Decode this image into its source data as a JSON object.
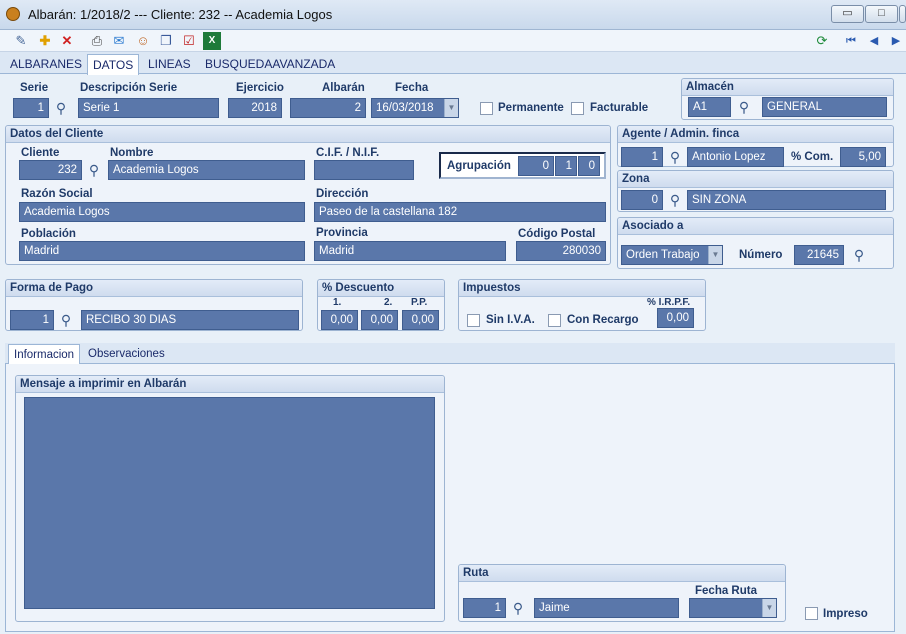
{
  "window": {
    "title": "Albarán: 1/2018/2  ---  Cliente: 232  --  Academia Logos"
  },
  "tabs": [
    "ALBARANES",
    "DATOS",
    "LINEAS",
    "BUSQUEDAAVANZADA"
  ],
  "header": {
    "serie_label": "Serie",
    "serie": "1",
    "desc_label": "Descripción Serie",
    "desc": "Serie 1",
    "ejercicio_label": "Ejercicio",
    "ejercicio": "2018",
    "albaran_label": "Albarán",
    "albaran": "2",
    "fecha_label": "Fecha",
    "fecha": "16/03/2018",
    "permanente": "Permanente",
    "facturable": "Facturable"
  },
  "almacen": {
    "title": "Almacén",
    "code": "A1",
    "name": "GENERAL"
  },
  "cliente": {
    "title": "Datos del Cliente",
    "cliente_label": "Cliente",
    "cliente": "232",
    "nombre_label": "Nombre",
    "nombre": "Academia Logos",
    "cif_label": "C.I.F. / N.I.F.",
    "cif": "",
    "agrupacion_label": "Agrupación",
    "agr1": "0",
    "agr2": "1",
    "agr3": "0",
    "razon_label": "Razón Social",
    "razon": "Academia Logos",
    "direccion_label": "Dirección",
    "direccion": "Paseo de la castellana 182",
    "poblacion_label": "Población",
    "poblacion": "Madrid",
    "provincia_label": "Provincia",
    "provincia": "Madrid",
    "cp_label": "Código Postal",
    "cp": "280030"
  },
  "agente": {
    "title": "Agente / Admin. finca",
    "code": "1",
    "name": "Antonio Lopez",
    "com_label": "% Com.",
    "com": "5,00"
  },
  "zona": {
    "title": "Zona",
    "code": "0",
    "name": "SIN ZONA"
  },
  "asociado": {
    "title": "Asociado a",
    "tipo": "Orden Trabajo",
    "numero_label": "Número",
    "numero": "21645"
  },
  "pago": {
    "title": "Forma de Pago",
    "code": "1",
    "name": "RECIBO 30 DIAS"
  },
  "descuento": {
    "title": "% Descuento",
    "l1": "1.",
    "l2": "2.",
    "l3": "P.P.",
    "v1": "0,00",
    "v2": "0,00",
    "v3": "0,00"
  },
  "impuestos": {
    "title": "Impuestos",
    "irpf_label": "% I.R.P.F.",
    "irpf": "0,00",
    "sin_iva": "Sin I.V.A.",
    "recargo": "Con Recargo"
  },
  "info": {
    "tabs": [
      "Informacion",
      "Observaciones"
    ],
    "mensaje_title": "Mensaje a imprimir en Albarán"
  },
  "ruta": {
    "title": "Ruta",
    "code": "1",
    "name": "Jaime",
    "fecha_label": "Fecha Ruta",
    "fecha": ""
  },
  "impreso": "Impreso",
  "colors": {
    "field": "#5a77aa",
    "panel": "#eef3fa",
    "label": "#1f3a68"
  }
}
